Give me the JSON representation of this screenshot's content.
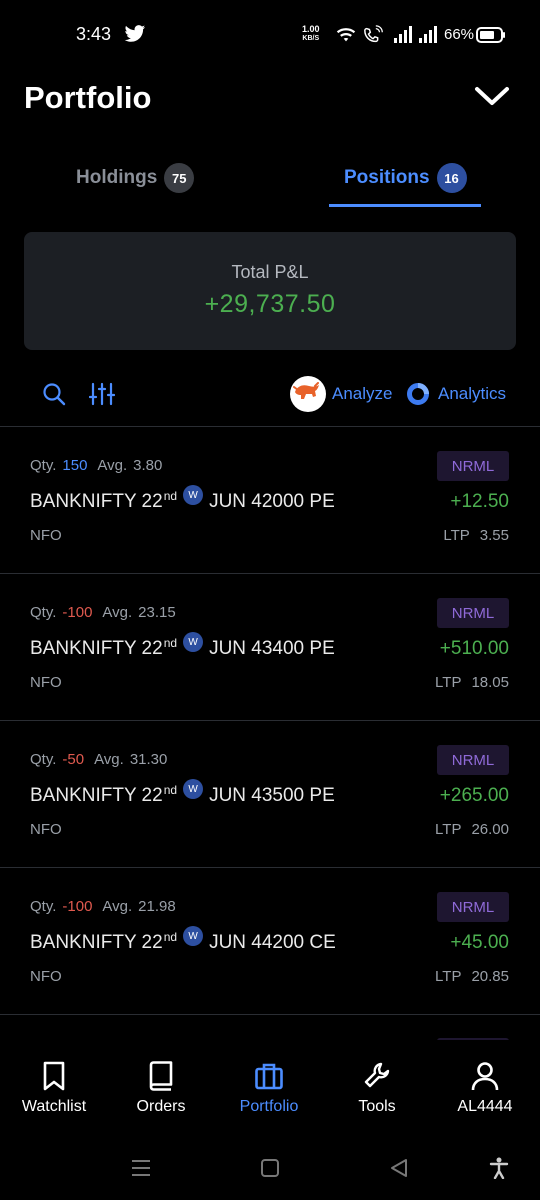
{
  "status_bar": {
    "time": "3:43",
    "net_speed_value": "1.00",
    "net_speed_unit": "KB/S",
    "battery": "66%"
  },
  "header": {
    "title": "Portfolio"
  },
  "tabs": [
    {
      "label": "Holdings",
      "count": "75",
      "active": false
    },
    {
      "label": "Positions",
      "count": "16",
      "active": true
    }
  ],
  "pnl": {
    "label": "Total P&L",
    "value": "+29,737.50"
  },
  "toolbar": {
    "analyze_label": "Analyze",
    "analytics_label": "Analytics"
  },
  "positions": [
    {
      "qty_label": "Qty.",
      "qty": "150",
      "avg_label": "Avg.",
      "avg": "3.80",
      "product": "NRML",
      "symbol": "BANKNIFTY 22",
      "suffix": "nd",
      "weekly": "W",
      "contract": "JUN 42000 PE",
      "pl": "+12.50",
      "exchange": "NFO",
      "ltp_label": "LTP",
      "ltp": "3.55"
    },
    {
      "qty_label": "Qty.",
      "qty": "-100",
      "avg_label": "Avg.",
      "avg": "23.15",
      "product": "NRML",
      "symbol": "BANKNIFTY 22",
      "suffix": "nd",
      "weekly": "W",
      "contract": "JUN 43400 PE",
      "pl": "+510.00",
      "exchange": "NFO",
      "ltp_label": "LTP",
      "ltp": "18.05"
    },
    {
      "qty_label": "Qty.",
      "qty": "-50",
      "avg_label": "Avg.",
      "avg": "31.30",
      "product": "NRML",
      "symbol": "BANKNIFTY 22",
      "suffix": "nd",
      "weekly": "W",
      "contract": "JUN 43500 PE",
      "pl": "+265.00",
      "exchange": "NFO",
      "ltp_label": "LTP",
      "ltp": "26.00"
    },
    {
      "qty_label": "Qty.",
      "qty": "-100",
      "avg_label": "Avg.",
      "avg": "21.98",
      "product": "NRML",
      "symbol": "BANKNIFTY 22",
      "suffix": "nd",
      "weekly": "W",
      "contract": "JUN 44200 CE",
      "pl": "+45.00",
      "exchange": "NFO",
      "ltp_label": "LTP",
      "ltp": "20.85"
    }
  ],
  "bottom_nav": [
    {
      "label": "Watchlist",
      "icon": "bookmark-icon"
    },
    {
      "label": "Orders",
      "icon": "book-icon"
    },
    {
      "label": "Portfolio",
      "icon": "briefcase-icon",
      "active": true
    },
    {
      "label": "Tools",
      "icon": "wrench-icon"
    },
    {
      "label": "AL4444",
      "icon": "user-icon"
    }
  ],
  "colors": {
    "accent": "#4c8dff",
    "profit": "#4caf50",
    "loss": "#e05a4f",
    "product_badge": "#8f6ad8"
  }
}
